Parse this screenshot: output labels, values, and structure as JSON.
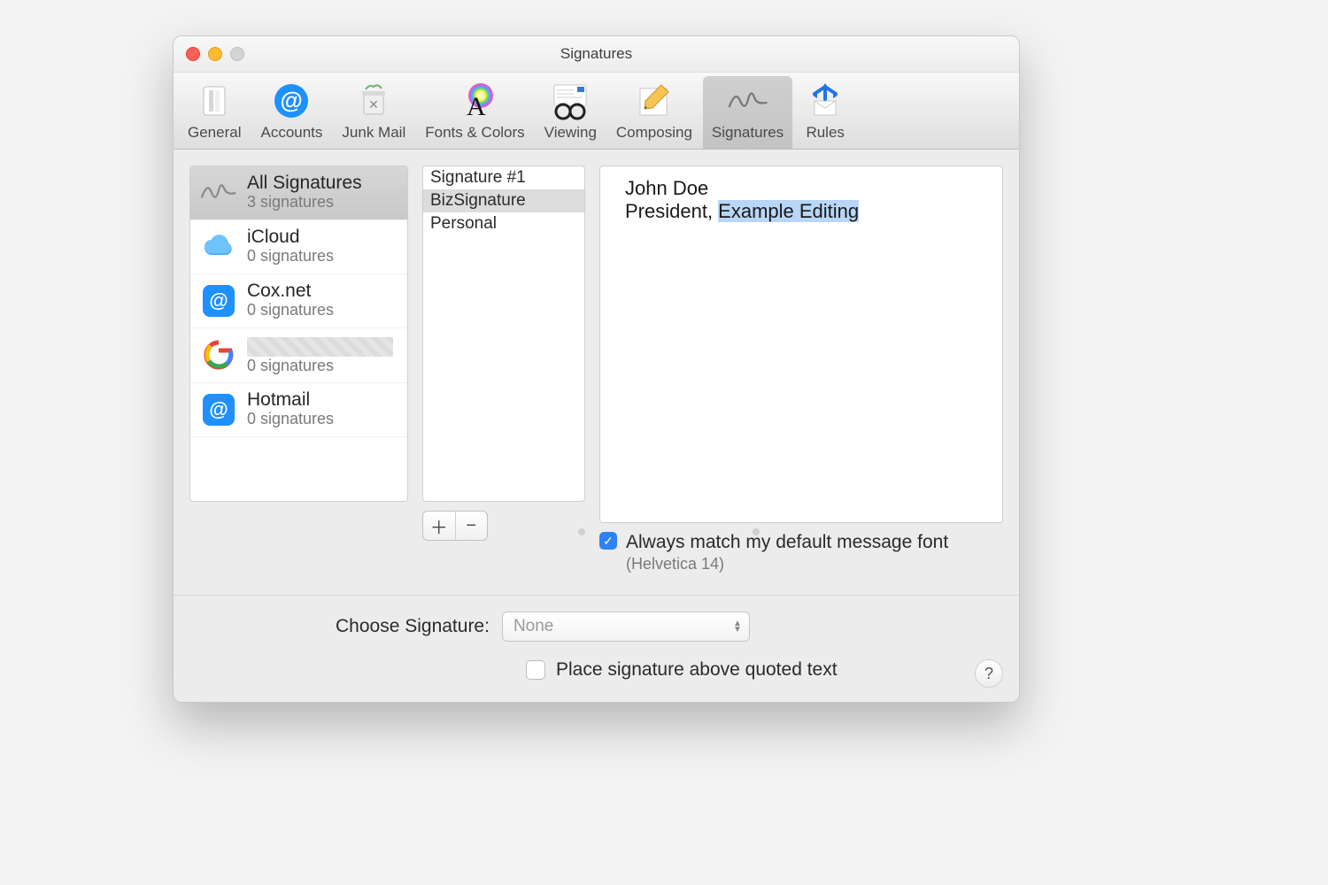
{
  "window": {
    "title": "Signatures"
  },
  "toolbar": {
    "items": [
      {
        "label": "General"
      },
      {
        "label": "Accounts"
      },
      {
        "label": "Junk Mail"
      },
      {
        "label": "Fonts & Colors"
      },
      {
        "label": "Viewing"
      },
      {
        "label": "Composing"
      },
      {
        "label": "Signatures"
      },
      {
        "label": "Rules"
      }
    ],
    "selected_index": 6
  },
  "accounts": {
    "selected_index": 0,
    "items": [
      {
        "name": "All Signatures",
        "sub": "3 signatures",
        "icon": "signature"
      },
      {
        "name": "iCloud",
        "sub": "0 signatures",
        "icon": "icloud"
      },
      {
        "name": "Cox.net",
        "sub": "0 signatures",
        "icon": "at"
      },
      {
        "name": "",
        "sub": "0 signatures",
        "icon": "google",
        "redacted": true
      },
      {
        "name": "Hotmail",
        "sub": "0 signatures",
        "icon": "at"
      }
    ]
  },
  "signatures": {
    "selected_index": 1,
    "items": [
      "Signature #1",
      "BizSignature",
      "Personal"
    ]
  },
  "editor": {
    "line1": "John Doe",
    "line2_prefix": "President, ",
    "line2_highlight": "Example Editing"
  },
  "options": {
    "match_font_checked": true,
    "match_font_label": "Always match my default message font",
    "match_font_sub": "(Helvetica 14)",
    "choose_label": "Choose Signature:",
    "choose_value": "None",
    "place_above_checked": false,
    "place_above_label": "Place signature above quoted text"
  }
}
